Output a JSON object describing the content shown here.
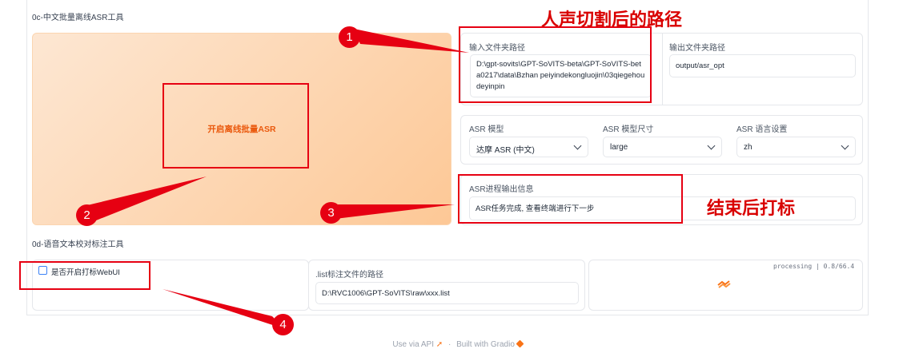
{
  "section_0c": {
    "title": "0c-中文批量离线ASR工具",
    "start_button": "开启离线批量ASR",
    "input_folder": {
      "label": "输入文件夹路径",
      "value": "D:\\gpt-sovits\\GPT-SoVITS-beta\\GPT-SoVITS-beta0217\\data\\Bzhan peiyindekongluojin\\03qiegehoudeyinpin"
    },
    "output_folder": {
      "label": "输出文件夹路径",
      "value": "output/asr_opt"
    },
    "asr_model": {
      "label": "ASR 模型",
      "value": "达摩 ASR (中文)"
    },
    "asr_model_size": {
      "label": "ASR 模型尺寸",
      "value": "large"
    },
    "asr_language": {
      "label": "ASR 语言设置",
      "value": "zh"
    },
    "asr_output": {
      "label": "ASR进程输出信息",
      "value": "ASR任务完成, 查看终端进行下一步"
    }
  },
  "section_0d": {
    "title": "0d-语音文本校对标注工具",
    "webui_checkbox": {
      "label": "是否开启打标WebUI",
      "checked": false
    },
    "list_path": {
      "label": ".list标注文件的路径",
      "value": "D:\\RVC1006\\GPT-SoVITS\\raw\\xxx.list"
    },
    "status": {
      "text": "processing | 0.8/66.4",
      "icon": "gradio-loading-icon"
    }
  },
  "annotations": {
    "title_top": "人声切割后的路径",
    "title_right": "结束后打标",
    "badges": [
      "1",
      "2",
      "3",
      "4"
    ],
    "color": "#e60012"
  },
  "footer": {
    "api_link": "Use via API",
    "separator": "·",
    "built_with": "Built with Gradio",
    "api_icon": "rocket-icon",
    "gradio_icon": "gradio-logo-icon"
  },
  "theme": {
    "accent": "#f97316",
    "button_gradient_start": "#fde4cc",
    "button_gradient_end": "#fdba74"
  }
}
